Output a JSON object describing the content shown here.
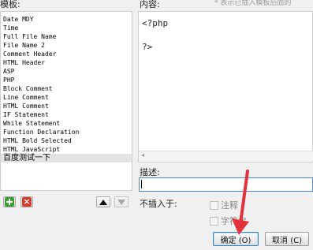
{
  "templates": {
    "label": "模板:",
    "items": [
      "Date MDY",
      "Time",
      "Full File Name",
      "File Name 2",
      "Comment Header",
      "HTML Header",
      "ASP",
      "PHP",
      "Block Comment",
      "Line Comment",
      "HTML Comment",
      "IF Statement",
      "While Statement",
      "Function Declaration",
      "HTML Bold Selected",
      "HTML JavaScript",
      "百度测试一下"
    ],
    "selected_index": 16
  },
  "content": {
    "label": "内容:",
    "hint": "表示已插入模板后面的",
    "lines": [
      "<?php",
      "?>"
    ]
  },
  "description": {
    "label": "描述:",
    "value": ""
  },
  "no_insert": {
    "label": "不插入于:",
    "options": [
      "注释",
      "字符串"
    ]
  },
  "buttons": {
    "ok": "确定 (O)",
    "cancel": "取消 (C)"
  },
  "colors": {
    "add_green": "#3aa035",
    "delete_red": "#d33a2c",
    "focus_blue": "#4a86c8",
    "arrow_red": "#e3323b"
  }
}
